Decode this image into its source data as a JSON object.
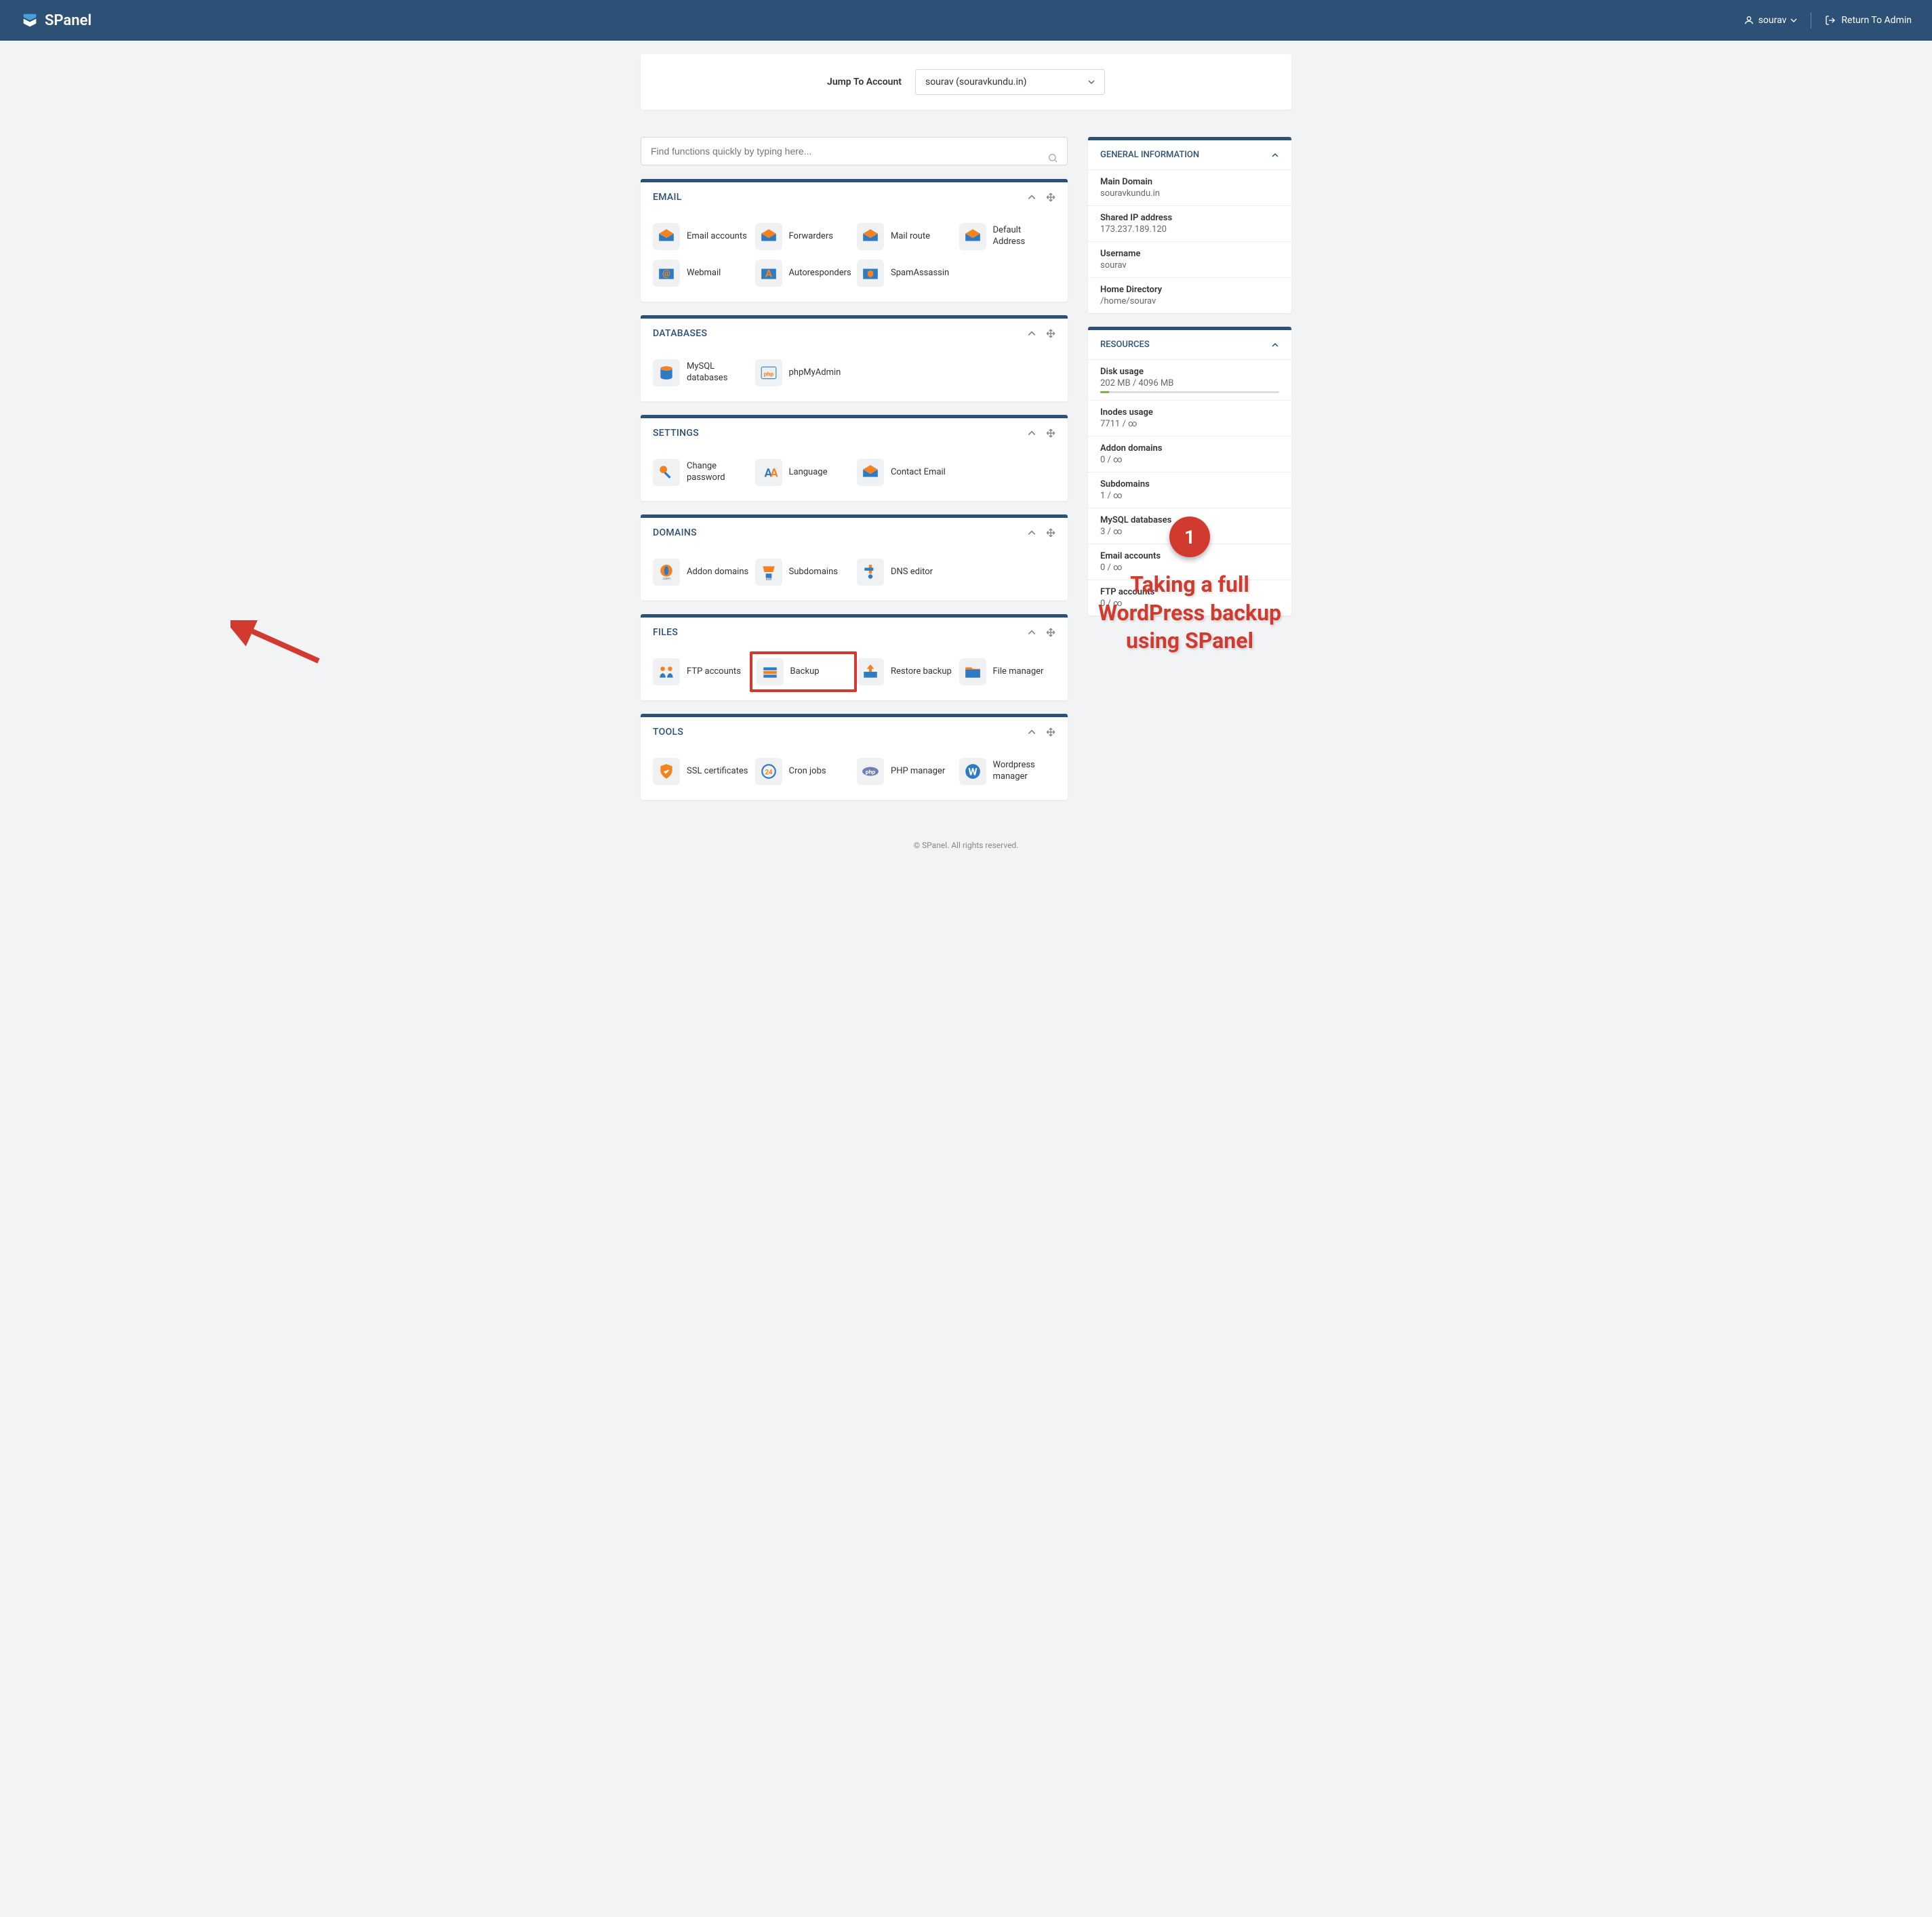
{
  "header": {
    "brand": "SPanel",
    "username": "sourav",
    "return_label": "Return To Admin"
  },
  "jump": {
    "label": "Jump To Account",
    "value": "sourav (souravkundu.in)"
  },
  "search": {
    "placeholder": "Find functions quickly by typing here..."
  },
  "sections": [
    {
      "title": "EMAIL",
      "items": [
        {
          "label": "Email accounts",
          "name": "email-accounts",
          "icon": "mail"
        },
        {
          "label": "Forwarders",
          "name": "forwarders",
          "icon": "mail"
        },
        {
          "label": "Mail route",
          "name": "mail-route",
          "icon": "mail"
        },
        {
          "label": "Default Address",
          "name": "default-address",
          "icon": "mail"
        },
        {
          "label": "Webmail",
          "name": "webmail",
          "icon": "mail-at"
        },
        {
          "label": "Autoresponders",
          "name": "autoresponders",
          "icon": "mail-a"
        },
        {
          "label": "SpamAssassin",
          "name": "spamassassin",
          "icon": "mail-shield"
        }
      ]
    },
    {
      "title": "DATABASES",
      "items": [
        {
          "label": "MySQL databases",
          "name": "mysql-databases",
          "icon": "db"
        },
        {
          "label": "phpMyAdmin",
          "name": "phpmyadmin",
          "icon": "pma"
        }
      ]
    },
    {
      "title": "SETTINGS",
      "items": [
        {
          "label": "Change password",
          "name": "change-password",
          "icon": "key"
        },
        {
          "label": "Language",
          "name": "language",
          "icon": "lang"
        },
        {
          "label": "Contact Email",
          "name": "contact-email",
          "icon": "mail"
        }
      ]
    },
    {
      "title": "DOMAINS",
      "items": [
        {
          "label": "Addon domains",
          "name": "addon-domains",
          "icon": "globe"
        },
        {
          "label": "Subdomains",
          "name": "subdomains",
          "icon": "sub"
        },
        {
          "label": "DNS editor",
          "name": "dns-editor",
          "icon": "dns"
        }
      ]
    },
    {
      "title": "FILES",
      "items": [
        {
          "label": "FTP accounts",
          "name": "ftp-accounts",
          "icon": "ftp"
        },
        {
          "label": "Backup",
          "name": "backup",
          "icon": "backup",
          "highlight": true
        },
        {
          "label": "Restore backup",
          "name": "restore-backup",
          "icon": "restore"
        },
        {
          "label": "File manager",
          "name": "file-manager",
          "icon": "folder"
        }
      ]
    },
    {
      "title": "TOOLS",
      "items": [
        {
          "label": "SSL certificates",
          "name": "ssl-certificates",
          "icon": "ssl"
        },
        {
          "label": "Cron jobs",
          "name": "cron-jobs",
          "icon": "cron"
        },
        {
          "label": "PHP manager",
          "name": "php-manager",
          "icon": "php"
        },
        {
          "label": "Wordpress manager",
          "name": "wordpress-manager",
          "icon": "wp"
        }
      ]
    }
  ],
  "general_info": {
    "title": "GENERAL INFORMATION",
    "rows": [
      {
        "label": "Main Domain",
        "value": "souravkundu.in"
      },
      {
        "label": "Shared IP address",
        "value": "173.237.189.120"
      },
      {
        "label": "Username",
        "value": "sourav"
      },
      {
        "label": "Home Directory",
        "value": "/home/sourav"
      }
    ]
  },
  "resources": {
    "title": "RESOURCES",
    "rows": [
      {
        "label": "Disk usage",
        "value": "202 MB / 4096 MB",
        "progress": 5
      },
      {
        "label": "Inodes usage",
        "value": "7711 / ∞"
      },
      {
        "label": "Addon domains",
        "value": "0 / ∞"
      },
      {
        "label": "Subdomains",
        "value": "1 / ∞"
      },
      {
        "label": "MySQL databases",
        "value": "3 / ∞"
      },
      {
        "label": "Email accounts",
        "value": "0 / ∞"
      },
      {
        "label": "FTP accounts",
        "value": "0 / ∞"
      }
    ]
  },
  "annotation": {
    "number": "1",
    "text": "Taking a full WordPress backup using SPanel"
  },
  "footer": "© SPanel. All rights reserved."
}
